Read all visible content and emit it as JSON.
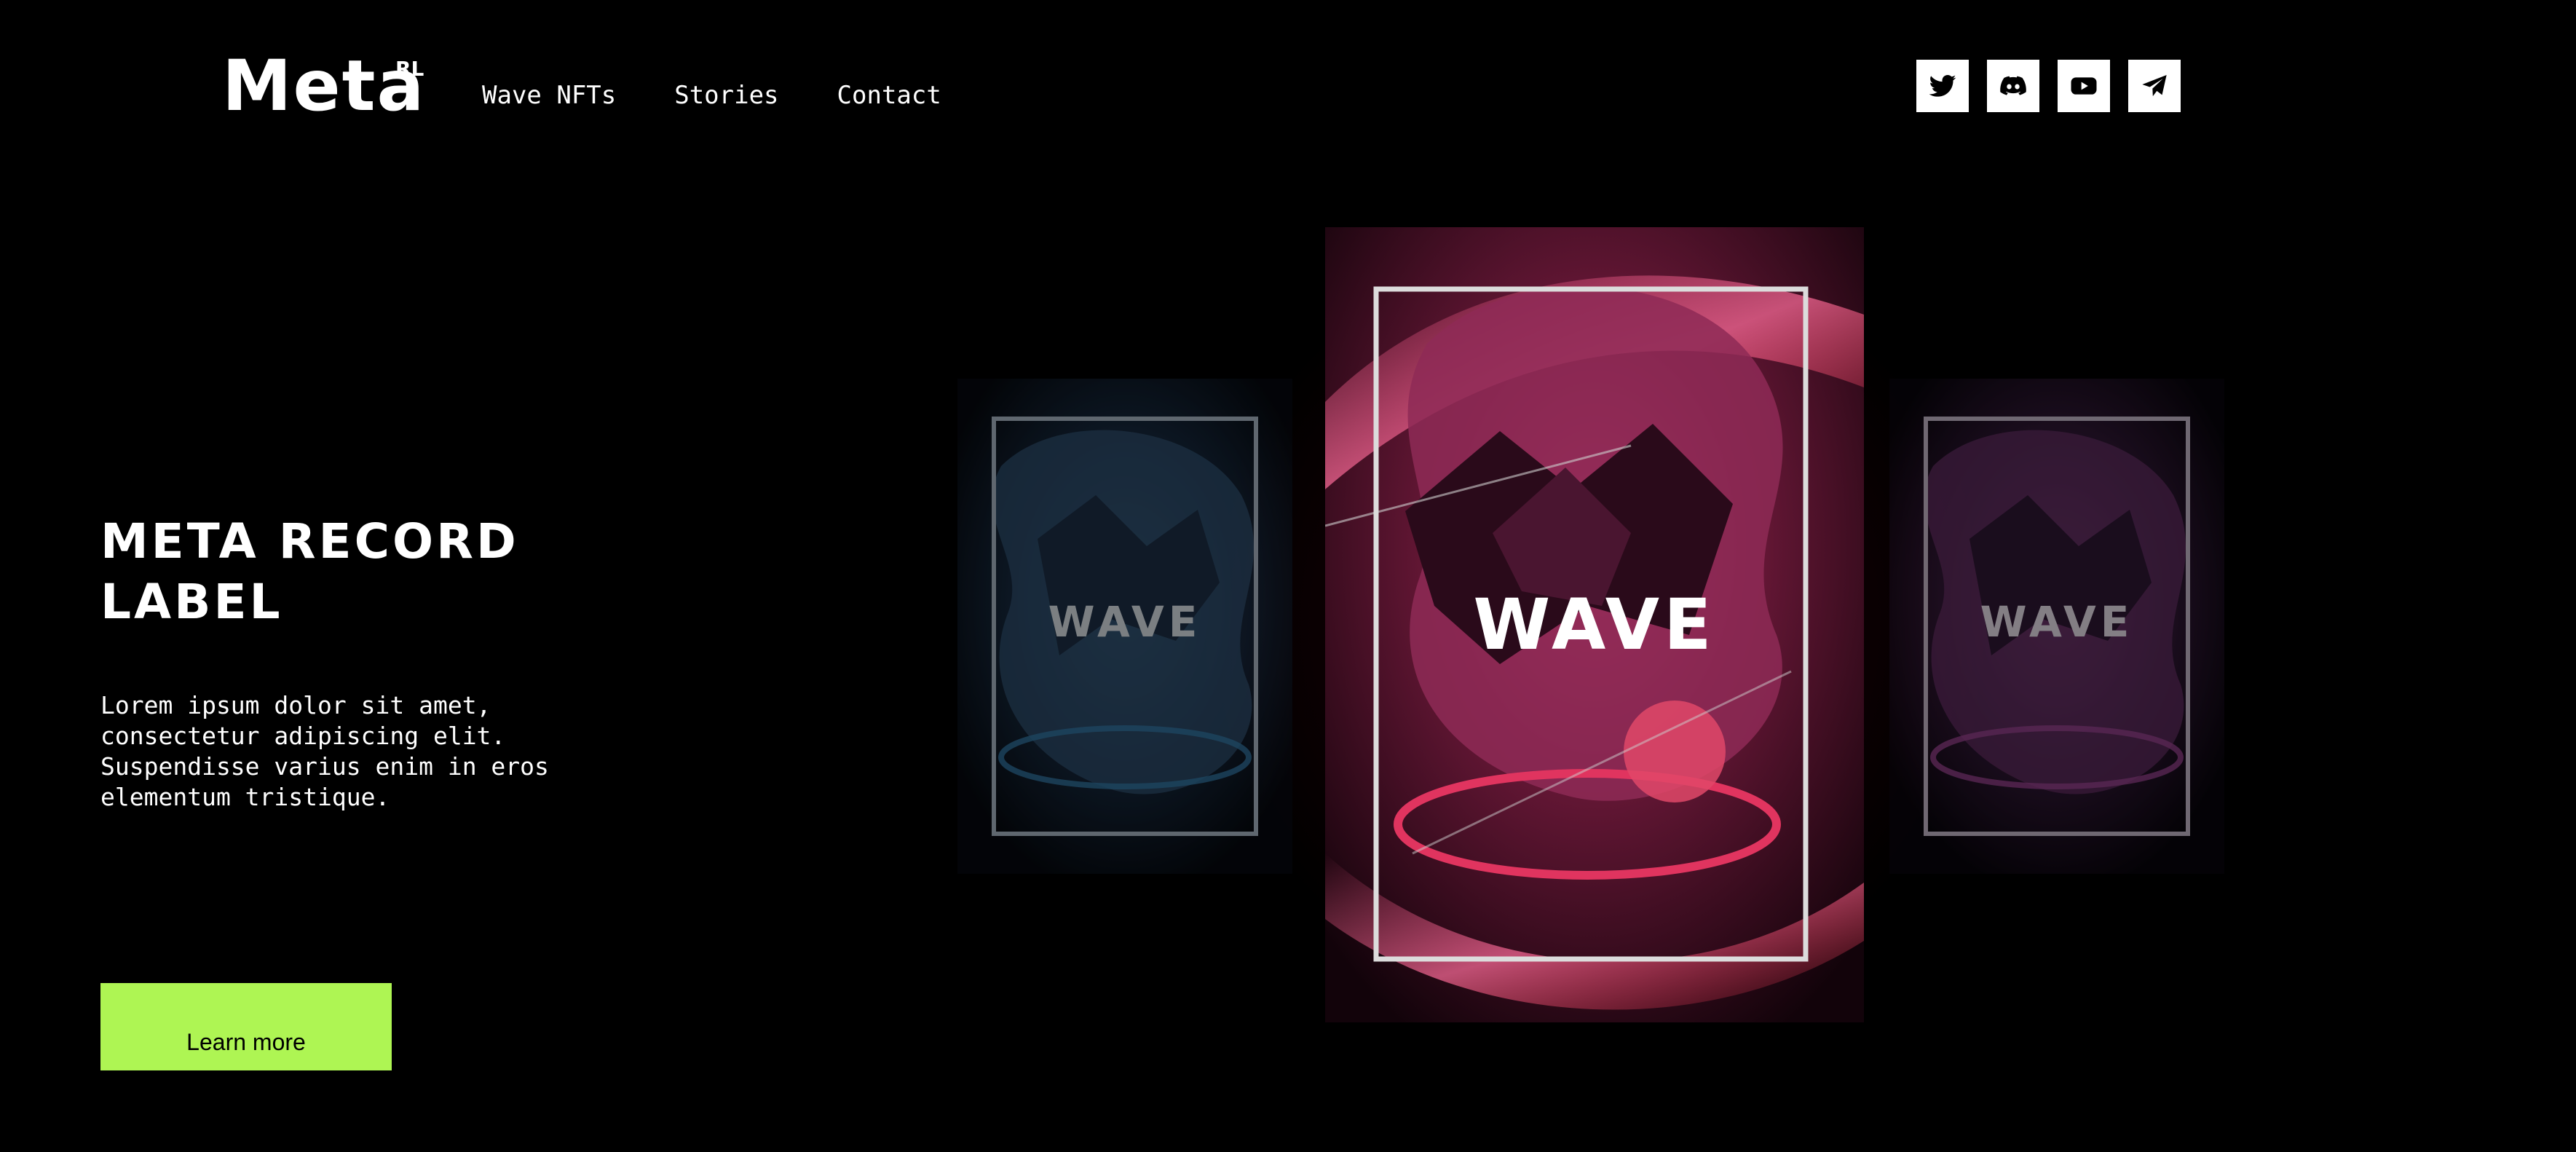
{
  "header": {
    "logo": {
      "text": "Meta",
      "sup": "RL"
    },
    "nav": [
      {
        "label": "Wave NFTs"
      },
      {
        "label": "Stories"
      },
      {
        "label": "Contact"
      }
    ],
    "socials": [
      {
        "icon": "twitter-icon"
      },
      {
        "icon": "discord-icon"
      },
      {
        "icon": "youtube-icon"
      },
      {
        "icon": "telegram-icon"
      }
    ]
  },
  "hero": {
    "title": "META RECORD LABEl",
    "description": "Lorem ipsum dolor sit amet,\nconsectetur adipiscing elit.\nSuspendisse varius enim in eros\nelementum tristique.",
    "cta_label": "Learn more"
  },
  "cards": {
    "left_label": "WAVE",
    "main_label": "WAVE",
    "right_label": "WAVE"
  },
  "colors": {
    "background": "#000000",
    "accent": "#aef553",
    "card_main": "#c0245a",
    "card_left": "#1d4a6e",
    "card_right": "#7a2c6c"
  }
}
